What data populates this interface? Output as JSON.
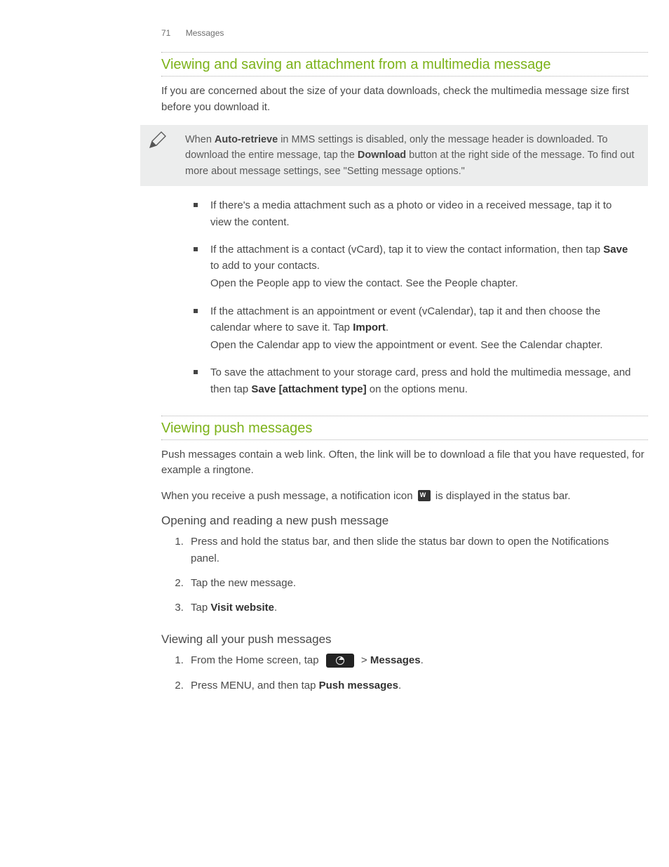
{
  "header": {
    "page_number": "71",
    "section": "Messages"
  },
  "s1": {
    "title": "Viewing and saving an attachment from a multimedia message",
    "intro": "If you are concerned about the size of your data downloads, check the multimedia message size first before you download it.",
    "note_p1a": "When ",
    "note_b1": "Auto-retrieve",
    "note_p1b": " in MMS settings is disabled, only the message header is downloaded. To download the entire message, tap the ",
    "note_b2": "Download",
    "note_p1c": " button at the right side of the message. To find out more about message settings, see \"Setting message options.\"",
    "bul1": "If there's a media attachment such as a photo or video in a received message, tap it to view the content.",
    "bul2a": "If the attachment is a contact (vCard), tap it to view the contact information, then tap ",
    "bul2_b": "Save",
    "bul2b": " to add to your contacts.",
    "bul2c": "Open the People app to view the contact. See the People chapter.",
    "bul3a": "If the attachment is an appointment or event (vCalendar), tap it and then choose the calendar where to save it. Tap ",
    "bul3_b": "Import",
    "bul3b": ".",
    "bul3c": "Open the Calendar app to view the appointment or event. See the Calendar chapter.",
    "bul4a": "To save the attachment to your storage card, press and hold the multimedia message, and then tap ",
    "bul4_b": "Save [attachment type]",
    "bul4b": " on the options menu."
  },
  "s2": {
    "title": "Viewing push messages",
    "intro": "Push messages contain a web link. Often, the link will be to download a file that you have requested, for example a ringtone.",
    "icon_line_a": "When you receive a push message, a notification icon ",
    "icon_line_b": " is displayed in the status bar.",
    "sub1": "Opening and reading a new push message",
    "st1": "Press and hold the status bar, and then slide the status bar down to open the Notifications panel.",
    "st2": "Tap the new message.",
    "st3a": "Tap ",
    "st3_b": "Visit website",
    "st3b": ".",
    "sub2": "Viewing all your push messages",
    "sb1a": "From the Home screen, tap ",
    "sb1b": " > ",
    "sb1_b": "Messages",
    "sb1c": ".",
    "sb2a": "Press MENU, and then tap ",
    "sb2_b": "Push messages",
    "sb2b": "."
  }
}
